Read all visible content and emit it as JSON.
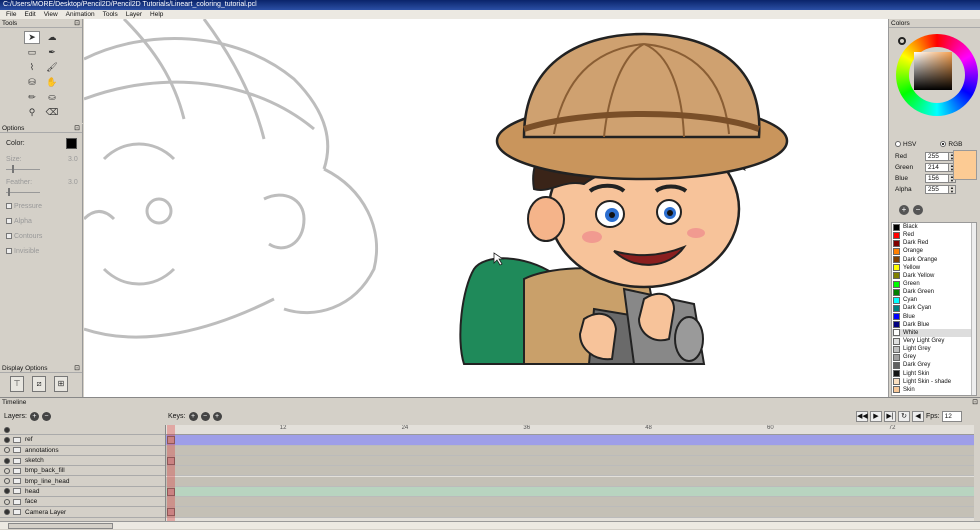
{
  "window": {
    "title": "C:/Users/MORE/Desktop/Pencil2D/Pencil2D Tutorials/Lineart_coloring_tutorial.pcl"
  },
  "menu": [
    "File",
    "Edit",
    "View",
    "Animation",
    "Tools",
    "Layer",
    "Help"
  ],
  "tools_panel": {
    "title": "Tools",
    "float": "⊡"
  },
  "options_panel": {
    "title": "Options",
    "color_label": "Color:",
    "size_label": "Size:",
    "size_value": "3.0",
    "feather_label": "Feather:",
    "feather_value": "3.0",
    "pressure": "Pressure",
    "alpha": "Alpha",
    "contours": "Contours",
    "invisible": "Invisible"
  },
  "display_options": {
    "title": "Display Options"
  },
  "colors_panel": {
    "title": "Colors",
    "hsv": "HSV",
    "rgb": "RGB",
    "red_label": "Red",
    "red": "255",
    "green_label": "Green",
    "green": "214",
    "blue_label": "Blue",
    "blue": "156",
    "alpha_label": "Alpha",
    "alpha": "255",
    "current_color": "#fccb94"
  },
  "palette": [
    {
      "name": "Black",
      "color": "#000000"
    },
    {
      "name": "Red",
      "color": "#ff0000"
    },
    {
      "name": "Dark Red",
      "color": "#800000"
    },
    {
      "name": "Orange",
      "color": "#ff8000"
    },
    {
      "name": "Dark Orange",
      "color": "#804000"
    },
    {
      "name": "Yellow",
      "color": "#ffff00"
    },
    {
      "name": "Dark Yellow",
      "color": "#808000"
    },
    {
      "name": "Green",
      "color": "#00ff00"
    },
    {
      "name": "Dark Green",
      "color": "#008000"
    },
    {
      "name": "Cyan",
      "color": "#00ffff"
    },
    {
      "name": "Dark Cyan",
      "color": "#008080"
    },
    {
      "name": "Blue",
      "color": "#0000ff"
    },
    {
      "name": "Dark Blue",
      "color": "#000080"
    },
    {
      "name": "White",
      "color": "#ffffff"
    },
    {
      "name": "Very Light Grey",
      "color": "#e0e0e0"
    },
    {
      "name": "Light Grey",
      "color": "#c0c0c0"
    },
    {
      "name": "Grey",
      "color": "#a0a0a0"
    },
    {
      "name": "Dark Grey",
      "color": "#606060"
    },
    {
      "name": "Light Skin",
      "color": "#141414"
    },
    {
      "name": "Light Skin - shade",
      "color": "#fce0c0"
    },
    {
      "name": "Skin",
      "color": "#f8c898"
    }
  ],
  "timeline": {
    "title": "Timeline",
    "layers_label": "Layers:",
    "keys_label": "Keys:",
    "fps_label": "Fps:",
    "fps": "12",
    "ruler_ticks": [
      "12",
      "24",
      "36",
      "48",
      "60",
      "72"
    ],
    "layers": [
      {
        "name": "ref",
        "color": "#9e9ee8",
        "key": true
      },
      {
        "name": "annotations",
        "color": "#c4c0b6",
        "key": false
      },
      {
        "name": "sketch",
        "color": "#c4c0b6",
        "key": true
      },
      {
        "name": "bmp_back_fill",
        "color": "#c4c0b6",
        "key": false
      },
      {
        "name": "bmp_line_head",
        "color": "#c4c0b6",
        "key": false
      },
      {
        "name": "head",
        "color": "#b8d4c0",
        "key": true
      },
      {
        "name": "face",
        "color": "#c4c0b6",
        "key": false
      },
      {
        "name": "Camera Layer",
        "color": "#c4c0b6",
        "key": true
      }
    ]
  }
}
